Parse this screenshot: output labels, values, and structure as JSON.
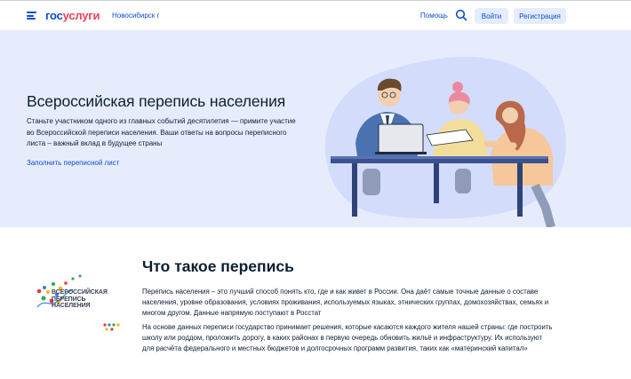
{
  "header": {
    "logo_part1": "гос",
    "logo_part2": "услуги",
    "city": "Новосибирск г",
    "help": "Помощь",
    "login": "Войти",
    "register": "Регистрация"
  },
  "hero": {
    "title": "Всероссийская перепись населения",
    "text_lines": [
      "Станьте участником одного из главных событий десятилетия — примите участие",
      "во Всероссийской переписи населения. Ваши ответы на вопросы переписного",
      "листа – важный вклад в будущее страны"
    ],
    "link": "Заполнить переписной лист"
  },
  "section": {
    "logo_lines": [
      "ВСЕРОССИЙСКАЯ",
      "ПЕРЕПИСЬ",
      "НАСЕЛЕНИЯ"
    ],
    "title": "Что такое перепись",
    "para1_lines": [
      "Перепись населения – это лучший способ понять кто, где и как живет в России. Она даёт самые точные данные о составе",
      "населения, уровне образования, условиях проживания, используемых языках, этнических группах, домохозяйствах, семьях и",
      "многом другом. Данные напрямую поступают в Росстат"
    ],
    "para2_lines": [
      "На основе данных переписи государство принимает решения, которые касаются каждого жителя нашей страны: где построить",
      "школу или роддом, проложить дорогу, в каких районах в первую очередь обновить жильё и инфраструктуру. Их используют",
      "для расчёта федерального и местных бюджетов и долгосрочных программ развития, таких как «материнский капитал»"
    ]
  },
  "colors": {
    "brand_blue": "#0d4cd3",
    "brand_red": "#ee3f58",
    "hero_bg": "#e7ecfd"
  }
}
